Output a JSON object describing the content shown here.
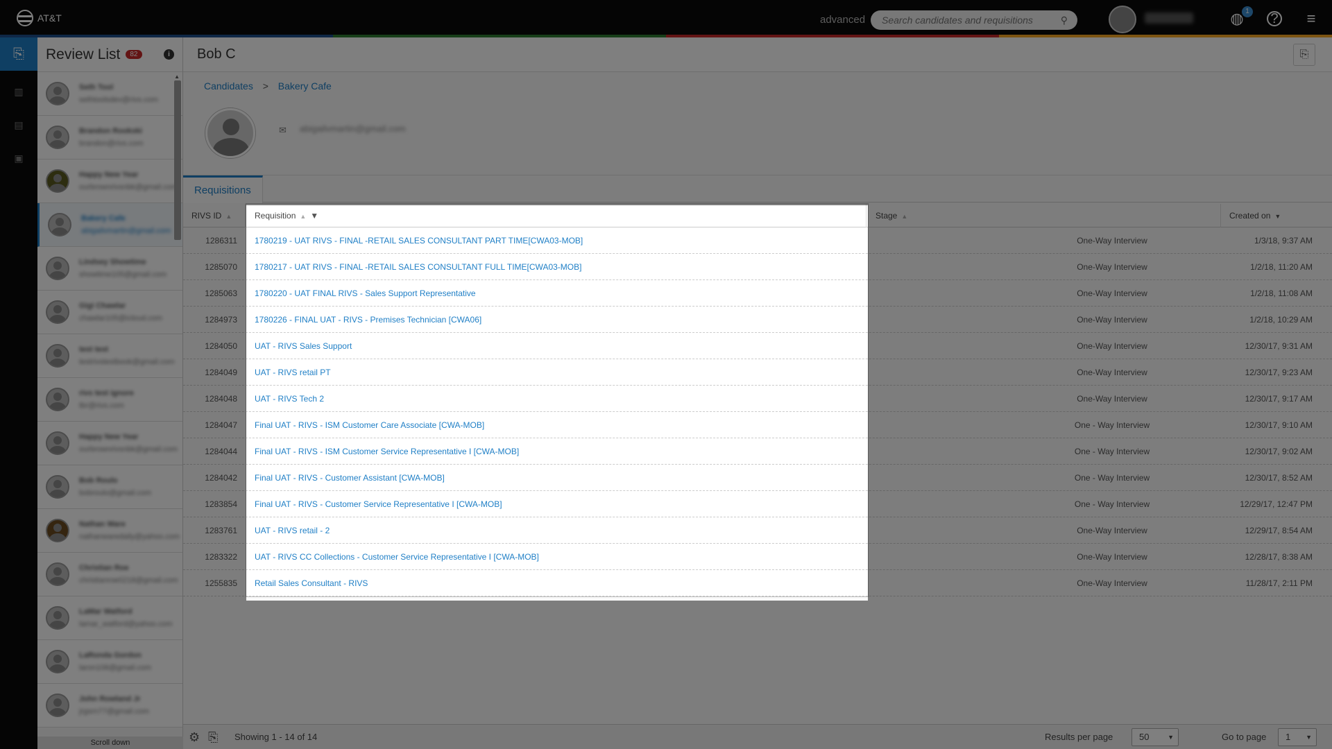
{
  "header": {
    "brand": "AT&T",
    "advanced_label": "advanced",
    "search_placeholder": "Search candidates and requisitions",
    "notification_count": "1",
    "stripe_colors": [
      "#1f4e8c",
      "#2e7d32",
      "#c62828",
      "#f9a825"
    ]
  },
  "review_list": {
    "title": "Review List",
    "count": "82",
    "scroll_label": "Scroll down",
    "candidates": [
      {
        "name": "Seth Tool",
        "email": "sethtoolsdev@rivs.com",
        "photo": "default"
      },
      {
        "name": "Brandon Rookski",
        "email": "brandon@rivs.com",
        "photo": "default"
      },
      {
        "name": "Happy New Year",
        "email": "ourbrownrivsnbk@gmail.com",
        "photo": "photo"
      },
      {
        "name": "Bakery Cafe",
        "email": "abigailvmartin@gmail.com",
        "photo": "default"
      },
      {
        "name": "Lindsey Showtime",
        "email": "showtime105@gmail.com",
        "photo": "default"
      },
      {
        "name": "Gigi Chawlar",
        "email": "chawlar105@icloud.com",
        "photo": "default"
      },
      {
        "name": "test test",
        "email": "testrivstestbook@gmail.com",
        "photo": "default"
      },
      {
        "name": "rivs test ignore",
        "email": "tbr@rivs.com",
        "photo": "default"
      },
      {
        "name": "Happy New Year",
        "email": "ourbrownrivsnbk@gmail.com",
        "photo": "default"
      },
      {
        "name": "Bob Roulo",
        "email": "bobroulo@gmail.com",
        "photo": "default"
      },
      {
        "name": "Nathan Ware",
        "email": "nathanwaredaily@yahoo.com",
        "photo": "photo2"
      },
      {
        "name": "Christian Roe",
        "email": "christianroe0218@gmail.com",
        "photo": "default"
      },
      {
        "name": "LaMar Watford",
        "email": "lamar_watford@yahoo.com",
        "photo": "default"
      },
      {
        "name": "LaRonda Gordon",
        "email": "laron106@gmail.com",
        "photo": "default"
      },
      {
        "name": "John Rowland Jr",
        "email": "jrgsrn77@gmail.com",
        "photo": "default"
      }
    ]
  },
  "main": {
    "title": "Bob C",
    "breadcrumb": [
      "Candidates",
      ">",
      "Bakery Cafe"
    ],
    "email": "abigailvmartin@gmail.com",
    "tab": "Requisitions",
    "columns": {
      "id": "RIVS ID",
      "requisition": "Requisition",
      "stage": "Stage",
      "created": "Created on"
    },
    "rows": [
      {
        "id": "1286311",
        "req": "1780219 - UAT RIVS - FINAL -RETAIL SALES CONSULTANT PART TIME[CWA03-MOB]",
        "stage": "One-Way Interview",
        "created": "1/3/18, 9:37 AM"
      },
      {
        "id": "1285070",
        "req": "1780217 - UAT RIVS - FINAL -RETAIL SALES CONSULTANT FULL TIME[CWA03-MOB]",
        "stage": "One-Way Interview",
        "created": "1/2/18, 11:20 AM"
      },
      {
        "id": "1285063",
        "req": "1780220 - UAT FINAL RIVS - Sales Support Representative",
        "stage": "One-Way Interview",
        "created": "1/2/18, 11:08 AM"
      },
      {
        "id": "1284973",
        "req": "1780226 - FINAL UAT - RIVS - Premises Technician [CWA06]",
        "stage": "One-Way Interview",
        "created": "1/2/18, 10:29 AM"
      },
      {
        "id": "1284050",
        "req": "UAT - RIVS Sales Support",
        "stage": "One-Way Interview",
        "created": "12/30/17, 9:31 AM"
      },
      {
        "id": "1284049",
        "req": "UAT - RIVS retail PT",
        "stage": "One-Way Interview",
        "created": "12/30/17, 9:23 AM"
      },
      {
        "id": "1284048",
        "req": "UAT - RIVS Tech 2",
        "stage": "One-Way Interview",
        "created": "12/30/17, 9:17 AM"
      },
      {
        "id": "1284047",
        "req": "Final UAT - RIVS - ISM Customer Care Associate [CWA-MOB]",
        "stage": "One - Way Interview",
        "created": "12/30/17, 9:10 AM"
      },
      {
        "id": "1284044",
        "req": "Final UAT - RIVS - ISM Customer Service Representative I [CWA-MOB]",
        "stage": "One - Way Interview",
        "created": "12/30/17, 9:02 AM"
      },
      {
        "id": "1284042",
        "req": "Final UAT - RIVS - Customer Assistant [CWA-MOB]",
        "stage": "One - Way Interview",
        "created": "12/30/17, 8:52 AM"
      },
      {
        "id": "1283854",
        "req": "Final UAT - RIVS - Customer Service Representative I [CWA-MOB]",
        "stage": "One - Way Interview",
        "created": "12/29/17, 12:47 PM"
      },
      {
        "id": "1283761",
        "req": "UAT - RIVS retail - 2",
        "stage": "One-Way Interview",
        "created": "12/29/17, 8:54 AM"
      },
      {
        "id": "1283322",
        "req": "UAT - RIVS CC Collections - Customer Service Representative I [CWA-MOB]",
        "stage": "One-Way Interview",
        "created": "12/28/17, 8:38 AM"
      },
      {
        "id": "1255835",
        "req": "Retail Sales Consultant - RIVS",
        "stage": "One-Way Interview",
        "created": "11/28/17, 2:11 PM"
      }
    ]
  },
  "footer": {
    "showing": "Showing 1 - 14 of 14",
    "results_label": "Results per page",
    "results_value": "50",
    "goto_label": "Go to page",
    "goto_value": "1"
  }
}
